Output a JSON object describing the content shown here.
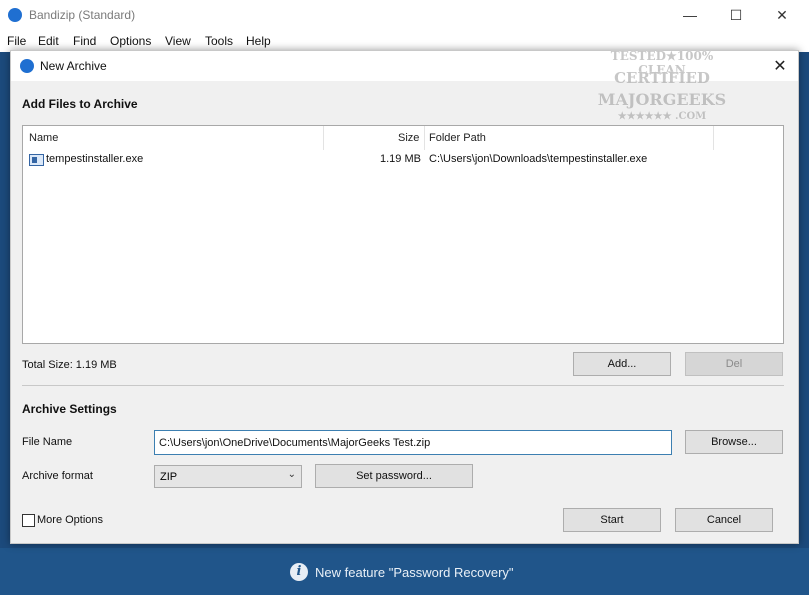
{
  "app": {
    "title": "Bandizip (Standard)",
    "window_controls": {
      "minimize": "—",
      "maximize": "☐",
      "close": "✕"
    }
  },
  "menu": [
    "File",
    "Edit",
    "Find",
    "Options",
    "View",
    "Tools",
    "Help"
  ],
  "dialog": {
    "title": "New Archive",
    "close": "✕",
    "add_files_heading": "Add Files to Archive",
    "columns": {
      "name": "Name",
      "size": "Size",
      "folder_path": "Folder Path"
    },
    "files": [
      {
        "name": "tempestinstaller.exe",
        "size": "1.19 MB",
        "folder_path": "C:\\Users\\jon\\Downloads\\tempestinstaller.exe"
      }
    ],
    "total_size": "Total Size:  1.19 MB",
    "add_button": "Add...",
    "del_button": "Del",
    "archive_settings_heading": "Archive Settings",
    "file_name_label": "File Name",
    "file_name_value": "C:\\Users\\jon\\OneDrive\\Documents\\MajorGeeks Test.zip",
    "browse_button": "Browse...",
    "archive_format_label": "Archive format",
    "archive_format_value": "ZIP",
    "set_password_button": "Set password...",
    "more_options_label": "More Options",
    "start_button": "Start",
    "cancel_button": "Cancel"
  },
  "status": {
    "text": "New feature \"Password Recovery\"",
    "icon": "i"
  },
  "watermark": {
    "line1": "TESTED★100% CLEAN",
    "line2": "CERTIFIED",
    "line3": "MAJORGEEKS",
    "line4": "★★★★★★ .COM"
  }
}
